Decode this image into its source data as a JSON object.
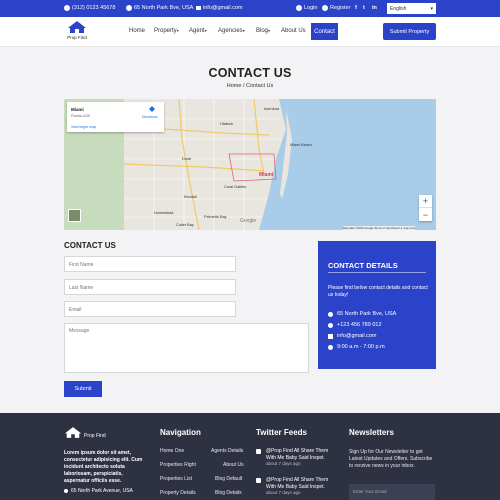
{
  "topbar": {
    "phone": "(312) 0123 45678",
    "address": "65 North Park Bve, USA",
    "email": "info@gmail.com",
    "login": "Login",
    "register": "Register",
    "social": [
      "f",
      "t",
      "in"
    ],
    "language": "English"
  },
  "header": {
    "logo_text": "Prop Find",
    "nav": [
      {
        "label": "Home"
      },
      {
        "label": "Property"
      },
      {
        "label": "Agent"
      },
      {
        "label": "Agencies"
      },
      {
        "label": "Blog"
      },
      {
        "label": "About Us"
      }
    ],
    "active": "Contact",
    "submit_property": "Submit Property"
  },
  "page": {
    "title": "CONTACT US",
    "breadcrumb": "Home / Contact Us"
  },
  "map": {
    "place_title": "Miami",
    "place_sub": "Florida USA",
    "view_larger": "View larger map",
    "directions": "Directions",
    "city_label": "Miami",
    "google": "Google",
    "attribution": "Map data ©2020 Google   Terms of Use   Report a map error",
    "zoom_in": "+",
    "zoom_out": "−",
    "cities": [
      "Hialeah",
      "Miami Beach",
      "Doral",
      "Homestead",
      "Kendall",
      "Coral Gables",
      "Palmetto Bay",
      "Cutler Bay",
      "Aventura"
    ]
  },
  "form": {
    "title": "CONTACT US",
    "first_name": "First Name",
    "last_name": "Last Name",
    "email": "Email",
    "message": "Message",
    "submit": "Submit"
  },
  "details": {
    "title": "CONTACT DETAILS",
    "desc": "Please find below contact details and contact us today!",
    "address": "65 North Park Bve, USA",
    "phone": "+123 456 789 012",
    "email": "info@gmail.com",
    "hours": "9:00 a.m - 7:00 p.m"
  },
  "footer": {
    "logo_text": "Prop Find",
    "about": "Lorem ipsum dolor sit amet, consectetur adipisicing elit. Cum incidunt architecto soluta laboriosam, perspiciatis, aspernatur officiis esse.",
    "address": "65 North Park Avenue, USA",
    "nav_title": "Navigation",
    "nav_col1": [
      "Home One",
      "Properties Right",
      "Properties List",
      "Property Details"
    ],
    "nav_col2": [
      "Agents Details",
      "About Us",
      "Blog Default",
      "Blog Details"
    ],
    "twitter_title": "Twitter Feeds",
    "tweets": [
      {
        "text": "@Prop Find All Share Them With Me Baby Said Inspet.",
        "ago": "about 7 days ago"
      },
      {
        "text": "@Prop Find All Share Them With Me Baby Said Inspet.",
        "ago": "about 7 days ago"
      }
    ],
    "newsletter_title": "Newsletters",
    "newsletter_text": "Sign Up for Our Newsletter to get Latest Updates and Offers. Subscribe to receive news in your inbox.",
    "newsletter_placeholder": "Enter Your Email"
  }
}
